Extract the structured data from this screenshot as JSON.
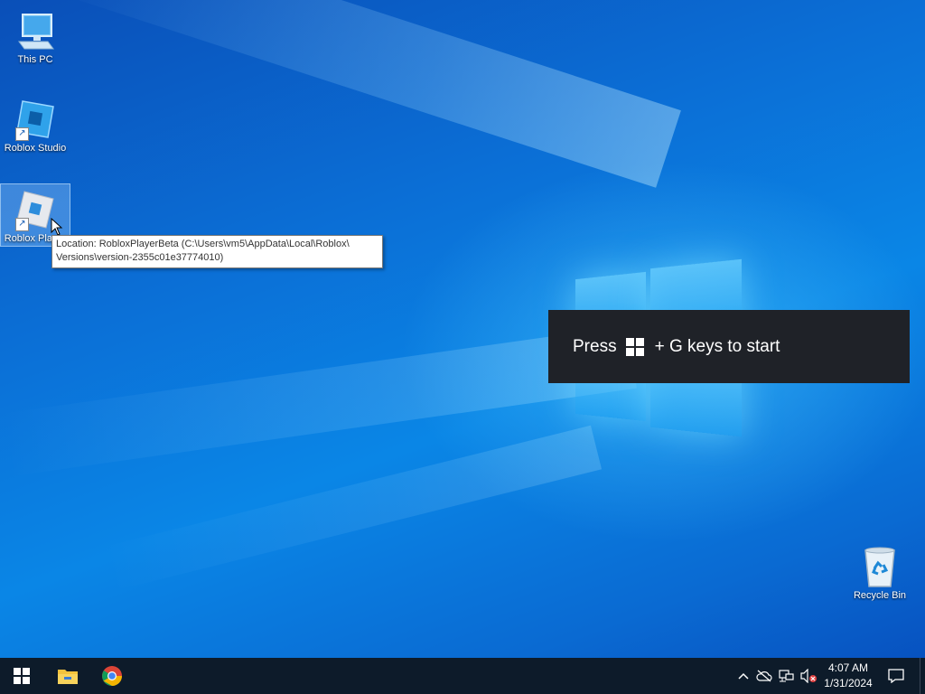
{
  "desktop": {
    "icons": [
      {
        "label": "This PC",
        "icon": "computer-icon"
      },
      {
        "label": "Roblox Studio",
        "icon": "roblox-studio-icon"
      },
      {
        "label": "Roblox Player",
        "icon": "roblox-player-icon"
      },
      {
        "label": "Recycle Bin",
        "icon": "recycle-bin-icon"
      }
    ],
    "tooltip": {
      "line1": "Location: RobloxPlayerBeta (C:\\Users\\vm5\\AppData\\Local\\Roblox\\",
      "line2": "Versions\\version-2355c01e37774010)"
    },
    "gamebar_toast": {
      "prefix": "Press",
      "suffix": "+ G keys to start"
    }
  },
  "taskbar": {
    "start_icon": "windows-logo-icon",
    "pinned": [
      {
        "name": "File Explorer",
        "icon": "folder-icon"
      },
      {
        "name": "Google Chrome",
        "icon": "chrome-icon"
      }
    ],
    "tray": {
      "time": "4:07 AM",
      "date": "1/31/2024"
    }
  },
  "colors": {
    "taskbar_bg": "#0d1b2a",
    "desktop_accent": "#0a78dc",
    "toast_bg": "#1f2228"
  }
}
